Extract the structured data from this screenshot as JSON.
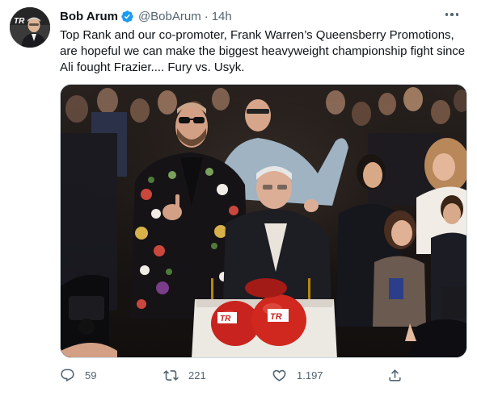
{
  "tweet": {
    "author_name": "Bob Arum",
    "author_handle": "@BobArum",
    "separator": "·",
    "timestamp": "14h",
    "text": "Top Rank and our co-promoter, Frank Warren’s Queensberry Promotions, are hopeful we can make the biggest heavyweight championship fight since Ali fought Frazier.... Fury vs. Usyk.",
    "verified": true,
    "media_alt": "",
    "stats": {
      "replies": "59",
      "retweets": "221",
      "likes": "1.197"
    }
  },
  "colors": {
    "text_primary": "#0f1419",
    "text_secondary": "#536471",
    "verified_badge": "#1d9bf0",
    "border": "#cfd9de"
  },
  "icons": {
    "verified": "verified-badge-icon",
    "more": "more-horizontal-icon",
    "reply": "reply-icon",
    "retweet": "retweet-icon",
    "like": "like-icon",
    "share": "share-icon"
  }
}
